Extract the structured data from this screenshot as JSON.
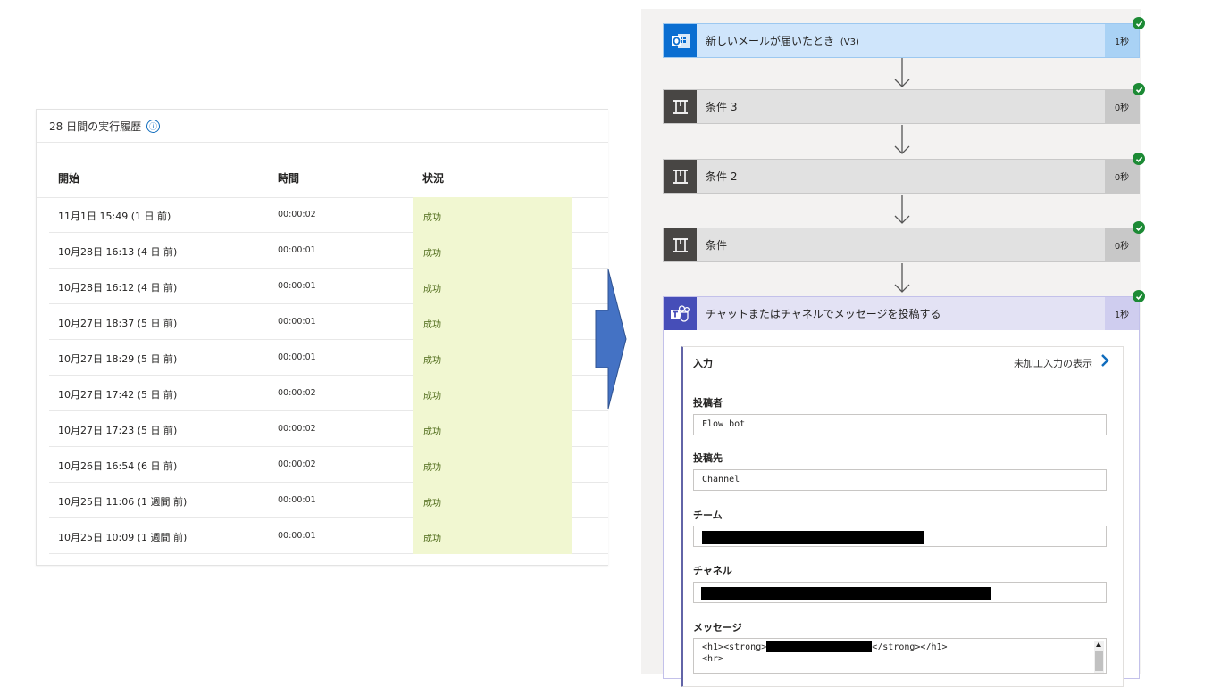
{
  "history": {
    "title": "28 日間の実行履歴",
    "info_icon": "ⓘ",
    "columns": {
      "start": "開始",
      "duration": "時間",
      "status": "状況"
    },
    "rows": [
      {
        "start": "11月1日 15:49 (1 日 前)",
        "duration": "00:00:02",
        "status": "成功"
      },
      {
        "start": "10月28日 16:13 (4 日 前)",
        "duration": "00:00:01",
        "status": "成功"
      },
      {
        "start": "10月28日 16:12 (4 日 前)",
        "duration": "00:00:01",
        "status": "成功"
      },
      {
        "start": "10月27日 18:37 (5 日 前)",
        "duration": "00:00:01",
        "status": "成功"
      },
      {
        "start": "10月27日 18:29 (5 日 前)",
        "duration": "00:00:01",
        "status": "成功"
      },
      {
        "start": "10月27日 17:42 (5 日 前)",
        "duration": "00:00:02",
        "status": "成功"
      },
      {
        "start": "10月27日 17:23 (5 日 前)",
        "duration": "00:00:02",
        "status": "成功"
      },
      {
        "start": "10月26日 16:54 (6 日 前)",
        "duration": "00:00:02",
        "status": "成功"
      },
      {
        "start": "10月25日 11:06 (1 週間 前)",
        "duration": "00:00:01",
        "status": "成功"
      },
      {
        "start": "10月25日 10:09 (1 週間 前)",
        "duration": "00:00:01",
        "status": "成功"
      }
    ]
  },
  "flow": {
    "steps": [
      {
        "title": "新しいメールが届いたとき",
        "suffix": "(V3)",
        "duration": "1秒",
        "icon": "outlook-icon"
      },
      {
        "title": "条件 3",
        "duration": "0秒",
        "icon": "condition-icon"
      },
      {
        "title": "条件 2",
        "duration": "0秒",
        "icon": "condition-icon"
      },
      {
        "title": "条件",
        "duration": "0秒",
        "icon": "condition-icon"
      },
      {
        "title": "チャットまたはチャネルでメッセージを投稿する",
        "duration": "1秒",
        "icon": "teams-icon"
      }
    ],
    "inputs": {
      "label": "入力",
      "raw_link": "未加工入力の表示",
      "fields": {
        "poster_label": "投稿者",
        "poster_value": "Flow bot",
        "post_in_label": "投稿先",
        "post_in_value": "Channel",
        "team_label": "チーム",
        "channel_label": "チャネル",
        "message_label": "メッセージ",
        "message_line1_start": "<h1><strong>",
        "message_line1_end": "</strong></h1>",
        "message_line2": "<hr>"
      }
    }
  },
  "colors": {
    "status_bg": "#f1f7d1",
    "success_check": "#1c8a35",
    "outlook_blue": "#0a6ed1",
    "teams_purple": "#464eb8",
    "arrow_fill": "#4472c4"
  }
}
